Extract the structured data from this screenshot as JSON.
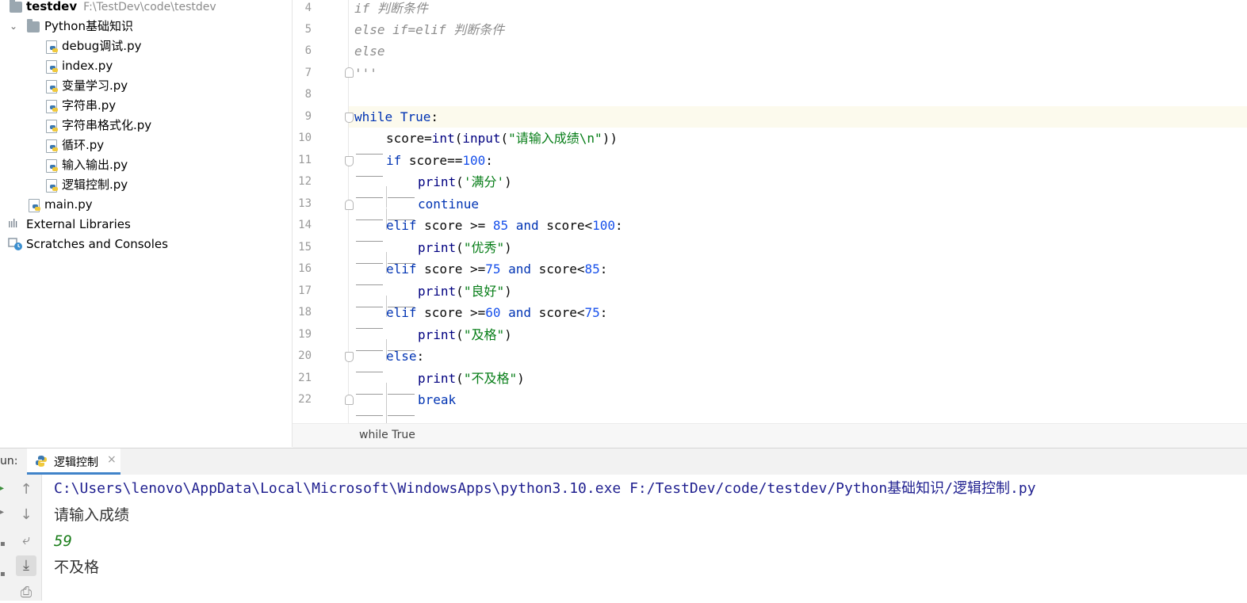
{
  "project": {
    "root_name": "testdev",
    "root_path": "F:\\TestDev\\code\\testdev",
    "folder": "Python基础知识",
    "files": [
      "debug调试.py",
      "index.py",
      "变量学习.py",
      "字符串.py",
      "字符串格式化.py",
      "循环.py",
      "输入输出.py",
      "逻辑控制.py"
    ],
    "main_file": "main.py",
    "external_libraries": "External Libraries",
    "scratches": "Scratches and Consoles"
  },
  "editor": {
    "line_numbers": [
      "4",
      "5",
      "6",
      "7",
      "8",
      "9",
      "10",
      "11",
      "12",
      "13",
      "14",
      "15",
      "16",
      "17",
      "18",
      "19",
      "20",
      "21",
      "22"
    ],
    "code": {
      "l4_a": "if",
      "l4_b": "判断条件",
      "l5_a": "else",
      "l5_b": "if=elif",
      "l5_c": "判断条件",
      "l6": "else",
      "l7": "'''",
      "l9_kw": "while",
      "l9_true": "True",
      "l9_colon": ":",
      "l10_a": "score=",
      "l10_fn": "int",
      "l10_b": "(",
      "l10_fn2": "input",
      "l10_c": "(",
      "l10_str": "\"请输入成绩\\n\"",
      "l10_d": "))",
      "l11_kw": "if",
      "l11_a": " score==",
      "l11_num": "100",
      "l11_b": ":",
      "l12_fn": "print",
      "l12_a": "(",
      "l12_str": "'满分'",
      "l12_b": ")",
      "l13_kw": "continue",
      "l14_kw": "elif",
      "l14_a": " score >= ",
      "l14_num": "85",
      "l14_and": " and",
      "l14_b": " score<",
      "l14_num2": "100",
      "l14_c": ":",
      "l15_fn": "print",
      "l15_a": "(",
      "l15_str": "\"优秀\"",
      "l15_b": ")",
      "l16_kw": "elif",
      "l16_a": " score >=",
      "l16_num": "75",
      "l16_and": " and",
      "l16_b": " score<",
      "l16_num2": "85",
      "l16_c": ":",
      "l17_fn": "print",
      "l17_a": "(",
      "l17_str": "\"良好\"",
      "l17_b": ")",
      "l18_kw": "elif",
      "l18_a": " score >=",
      "l18_num": "60",
      "l18_and": " and",
      "l18_b": " score<",
      "l18_num2": "75",
      "l18_c": ":",
      "l19_fn": "print",
      "l19_a": "(",
      "l19_str": "\"及格\"",
      "l19_b": ")",
      "l20_kw": "else",
      "l20_a": ":",
      "l21_fn": "print",
      "l21_a": "(",
      "l21_str": "\"不及格\"",
      "l21_b": ")",
      "l22_kw": "break"
    },
    "breadcrumb": "while True"
  },
  "run": {
    "label": "un:",
    "tab_label": "逻辑控制",
    "tab_close": "×",
    "console": {
      "command": "C:\\Users\\lenovo\\AppData\\Local\\Microsoft\\WindowsApps\\python3.10.exe F:/TestDev/code/testdev/Python基础知识/逻辑控制.py",
      "prompt": "请输入成绩",
      "input_value": "59",
      "output": "不及格"
    }
  },
  "colors": {
    "keyword": "#0033b3",
    "number": "#1750eb",
    "string": "#067d17",
    "comment": "#8c8c8c",
    "current_line": "#fcfaed",
    "tab_underline": "#4083c9"
  }
}
